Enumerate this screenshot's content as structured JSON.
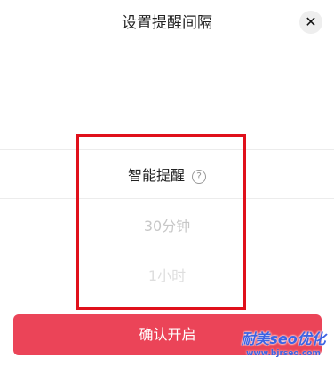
{
  "header": {
    "title": "设置提醒间隔",
    "close_symbol": "✕"
  },
  "picker": {
    "options": [
      {
        "label": "智能提醒",
        "selected": true,
        "help_symbol": "?"
      },
      {
        "label": "30分钟",
        "selected": false
      },
      {
        "label": "1小时",
        "selected": false
      }
    ]
  },
  "footer": {
    "confirm_label": "确认开启"
  },
  "watermark": {
    "text": "耐美seo优化",
    "url": "www.bjrseo.com"
  },
  "colors": {
    "accent": "#eb4458",
    "annotation_box": "#e0101b",
    "watermark": "#3d63e3"
  },
  "icons": {
    "close": "close-icon",
    "help": "question-circle-icon"
  }
}
